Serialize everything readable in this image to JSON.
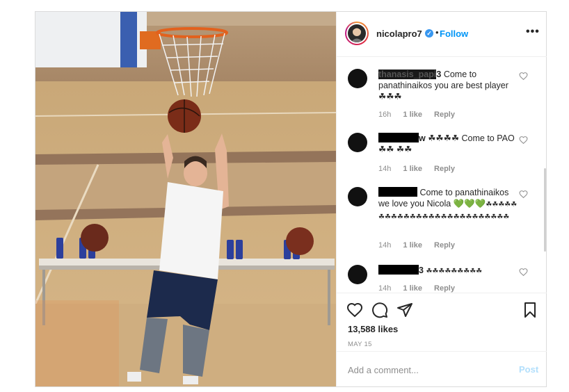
{
  "post": {
    "username": "nicolapro7",
    "verified": true,
    "separator": "•",
    "follow_label": "Follow",
    "more_label": "•••",
    "like_count": "13,588 likes",
    "date": "MAY 15",
    "comment_placeholder": "Add a comment...",
    "post_label": "Post"
  },
  "comments": [
    {
      "visible_name_fragment": "thanasis_papi",
      "name_suffix": "3",
      "text": "Come to panathinaikos you are best player ☘☘☘",
      "time": "16h",
      "likes": "1 like",
      "reply": "Reply"
    },
    {
      "visible_name_fragment": "w",
      "name_suffix": "",
      "text": "☘☘☘☘ Come to PAO ☘☘ ☘☘",
      "time": "14h",
      "likes": "1 like",
      "reply": "Reply"
    },
    {
      "visible_name_fragment": "",
      "name_suffix": "",
      "text": "Come to panathinaikos we love you Nicola",
      "emoji_green": "💚💚💚",
      "emoji_tail": "☘☘☘☘☘☘☘☘☘☘☘☘☘☘☘☘☘☘☘☘☘☘☘☘☘☘",
      "time": "14h",
      "likes": "1 like",
      "reply": "Reply"
    },
    {
      "visible_name_fragment": "",
      "name_suffix": "3",
      "text": "☘☘☘☘☘☘☘☘☘",
      "time": "14h",
      "likes": "1 like",
      "reply": "Reply"
    }
  ],
  "icons": {
    "like": "heart-icon",
    "comment": "comment-icon",
    "share": "paper-plane-icon",
    "save": "bookmark-icon",
    "comment_like": "small-heart-icon"
  },
  "colors": {
    "follow": "#0095f6",
    "verified": "#3897f0",
    "post_disabled": "#b2dffc",
    "meta_gray": "#8e8e8e"
  }
}
